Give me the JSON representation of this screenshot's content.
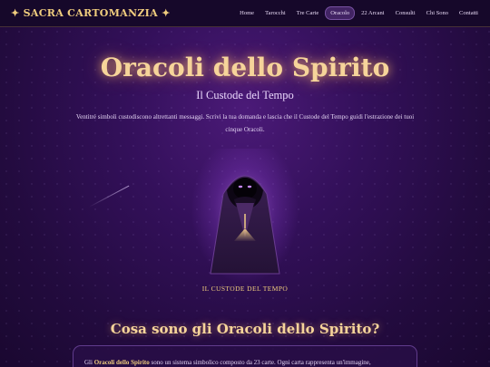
{
  "nav": {
    "brand": "✦ SACRA CARTOMANZIA ✦",
    "items": [
      {
        "label": "Home",
        "active": false
      },
      {
        "label": "Tarocchi",
        "active": false
      },
      {
        "label": "Tre Carte",
        "active": false
      },
      {
        "label": "Oracolo",
        "active": true
      },
      {
        "label": "22 Arcani",
        "active": false
      },
      {
        "label": "Consulti",
        "active": false
      },
      {
        "label": "Chi Sono",
        "active": false
      },
      {
        "label": "Contatti",
        "active": false
      }
    ]
  },
  "hero": {
    "title": "Oracoli dello Spirito",
    "subtitle": "Il Custode del Tempo",
    "intro": "Ventitré simboli custodiscono altrettanti messaggi. Scrivi la tua domanda e lascia che il Custode del Tempo guidi l'estrazione dei tuoi cinque Oracoli."
  },
  "guardian": {
    "label": "IL CUSTODE DEL TEMPO",
    "icon": "hooded-guardian-icon"
  },
  "section": {
    "title": "Cosa sono gli Oracoli dello Spirito?",
    "text_prefix": "Gli ",
    "text_bold": "Oracoli dello Spirito",
    "text_suffix": " sono un sistema simbolico composto da 23 carte. Ogni carta rappresenta un'immagine,"
  },
  "colors": {
    "gold": "#f0cd7e",
    "title_gold": "#f6d49a",
    "background": "#2a0d4a",
    "nav_bg": "#16082a"
  }
}
